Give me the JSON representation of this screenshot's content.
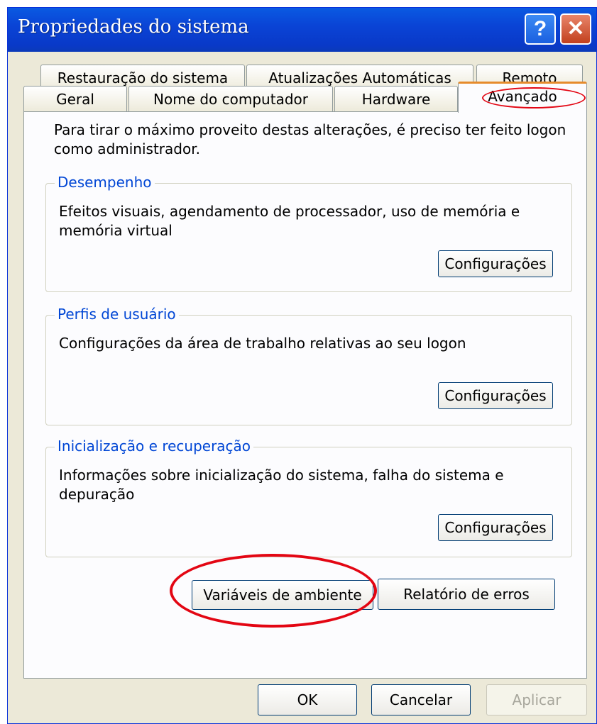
{
  "window": {
    "title": "Propriedades do sistema",
    "help_glyph": "?",
    "close_glyph": "✕"
  },
  "tabs": {
    "row_back": [
      {
        "label": "Restauração do sistema"
      },
      {
        "label": "Atualizações Automáticas"
      },
      {
        "label": "Remoto"
      }
    ],
    "row_front": [
      {
        "label": "Geral"
      },
      {
        "label": "Nome do computador"
      },
      {
        "label": "Hardware"
      },
      {
        "label": "Avançado",
        "active": true
      }
    ]
  },
  "panel": {
    "intro": "Para tirar o máximo proveito destas alterações, é preciso ter feito logon como administrador.",
    "groups": [
      {
        "legend": "Desempenho",
        "text": "Efeitos visuais, agendamento de processador, uso de memória e memória virtual",
        "button": "Configurações"
      },
      {
        "legend": "Perfis de usuário",
        "text": "Configurações da área de trabalho relativas ao seu logon",
        "button": "Configurações"
      },
      {
        "legend": "Inicialização e recuperação",
        "text": "Informações sobre inicialização do sistema, falha do sistema e depuração",
        "button": "Configurações"
      }
    ],
    "env_button": "Variáveis de ambiente",
    "error_report_button": "Relatório de erros"
  },
  "footer": {
    "ok": "OK",
    "cancel": "Cancelar",
    "apply": "Aplicar"
  },
  "colors": {
    "titlebar": "#0a4bd9",
    "group_legend": "#0046d5",
    "annotation": "#e30613",
    "active_tab_accent": "#e68b2c"
  }
}
